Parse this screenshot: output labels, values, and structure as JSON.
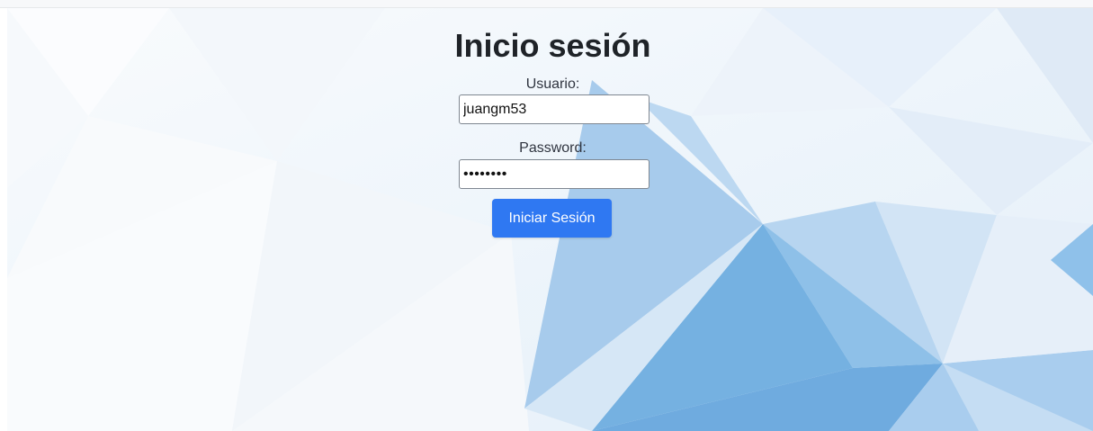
{
  "login": {
    "title": "Inicio sesión",
    "username_label": "Usuario:",
    "username_value": "juangm53",
    "password_label": "Password:",
    "password_value": "••••••••",
    "submit_label": "Iniciar Sesión"
  },
  "colors": {
    "button_bg": "#2f78f2",
    "background_accent": "#7db3e3"
  }
}
